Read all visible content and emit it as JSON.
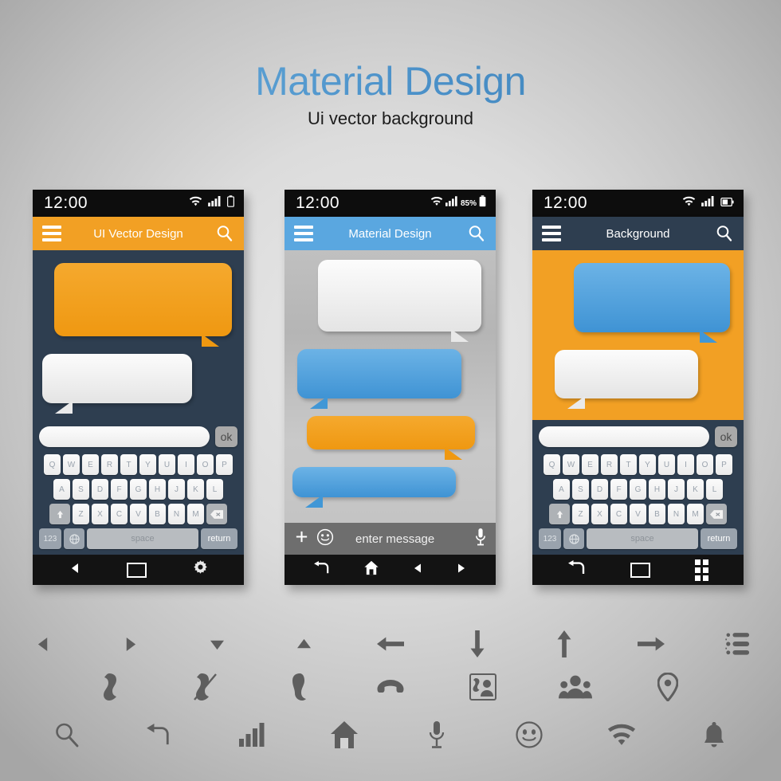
{
  "header": {
    "title": "Material Design",
    "subtitle": "Ui vector background",
    "title_color": "#4a90c8",
    "subtitle_color": "#1c1c1c"
  },
  "colors": {
    "orange": "#f2a024",
    "blue": "#5aa7e0",
    "navy": "#2e3e50",
    "white_bubble": "#f0f0f0",
    "status_black": "#0d0d0d",
    "page_background": "#c8c8c8"
  },
  "phones": [
    {
      "id": "phone-1",
      "status": {
        "time": "12:00",
        "wifi": "wifi-icon",
        "signal": "signal-bars-icon",
        "battery": "battery-icon",
        "battery_percent": ""
      },
      "appbar": {
        "menu": "hamburger-icon",
        "title": "UI Vector Design",
        "search": "search-icon",
        "color": "#f2a024"
      },
      "chat": {
        "background": "#2e3e50",
        "bubbles": [
          {
            "color": "orange",
            "tail": "right"
          },
          {
            "color": "white",
            "tail": "left"
          }
        ]
      },
      "keyboard": {
        "ok_label": "ok",
        "rows": [
          [
            "Q",
            "W",
            "E",
            "R",
            "T",
            "Y",
            "U",
            "I",
            "O",
            "P"
          ],
          [
            "A",
            "S",
            "D",
            "F",
            "G",
            "H",
            "J",
            "K",
            "L"
          ],
          [
            "Z",
            "X",
            "C",
            "V",
            "B",
            "N",
            "M"
          ]
        ],
        "shift_label": "shift-key",
        "backspace_label": "backspace-key",
        "num_label": "123",
        "globe_label": "globe-key",
        "space_label": "space",
        "return_label": "return"
      },
      "navbar": [
        "back-triangle-icon",
        "square-icon",
        "gear-icon"
      ]
    },
    {
      "id": "phone-2",
      "status": {
        "time": "12:00",
        "wifi": "wifi-icon",
        "signal": "signal-bars-icon",
        "battery": "battery-icon",
        "battery_percent": "85%"
      },
      "appbar": {
        "menu": "hamburger-icon",
        "title": "Material Design",
        "search": "search-icon",
        "color": "#5aa7e0"
      },
      "chat": {
        "background": "#c0c0c0",
        "bubbles": [
          {
            "color": "white",
            "tail": "right"
          },
          {
            "color": "blue",
            "tail": "left"
          },
          {
            "color": "orange",
            "tail": "right"
          },
          {
            "color": "blue",
            "tail": "left"
          }
        ]
      },
      "msgbar": {
        "add": "plus-icon",
        "emoji": "smiley-icon",
        "placeholder": "enter message",
        "mic": "microphone-icon"
      },
      "navbar": [
        "back-arrow-icon",
        "home-icon",
        "left-triangle-icon",
        "right-triangle-icon"
      ]
    },
    {
      "id": "phone-3",
      "status": {
        "time": "12:00",
        "wifi": "wifi-icon",
        "signal": "signal-bars-icon",
        "battery": "battery-icon",
        "battery_percent": ""
      },
      "appbar": {
        "menu": "hamburger-icon",
        "title": "Background",
        "search": "search-icon",
        "color": "#2e3e50"
      },
      "chat": {
        "background": "#f2a024",
        "bubbles": [
          {
            "color": "blue",
            "tail": "right"
          },
          {
            "color": "white",
            "tail": "left"
          }
        ]
      },
      "keyboard": {
        "ok_label": "ok",
        "rows": [
          [
            "Q",
            "W",
            "E",
            "R",
            "T",
            "Y",
            "U",
            "I",
            "O",
            "P"
          ],
          [
            "A",
            "S",
            "D",
            "F",
            "G",
            "H",
            "J",
            "K",
            "L"
          ],
          [
            "Z",
            "X",
            "C",
            "V",
            "B",
            "N",
            "M"
          ]
        ],
        "shift_label": "shift-key",
        "backspace_label": "backspace-key",
        "num_label": "123",
        "globe_label": "globe-key",
        "space_label": "space",
        "return_label": "return"
      },
      "navbar": [
        "back-arrow-icon",
        "square-icon",
        "grid-apps-icon"
      ]
    }
  ],
  "icon_gallery": {
    "color": "#5e5e5e",
    "rows": [
      [
        "left-triangle-icon",
        "right-triangle-icon",
        "down-triangle-icon",
        "up-triangle-icon",
        "left-arrow-icon",
        "down-arrow-icon",
        "up-arrow-icon",
        "right-arrow-icon",
        "list-icon"
      ],
      [
        "phone-icon",
        "phone-missed-icon",
        "phone-handset-icon",
        "phone-hangup-icon",
        "contact-card-icon",
        "group-people-icon",
        "location-pin-icon"
      ],
      [
        "search-icon",
        "undo-arrow-icon",
        "signal-bars-icon",
        "home-icon",
        "microphone-icon",
        "smiley-icon",
        "wifi-icon",
        "bell-icon"
      ]
    ]
  }
}
